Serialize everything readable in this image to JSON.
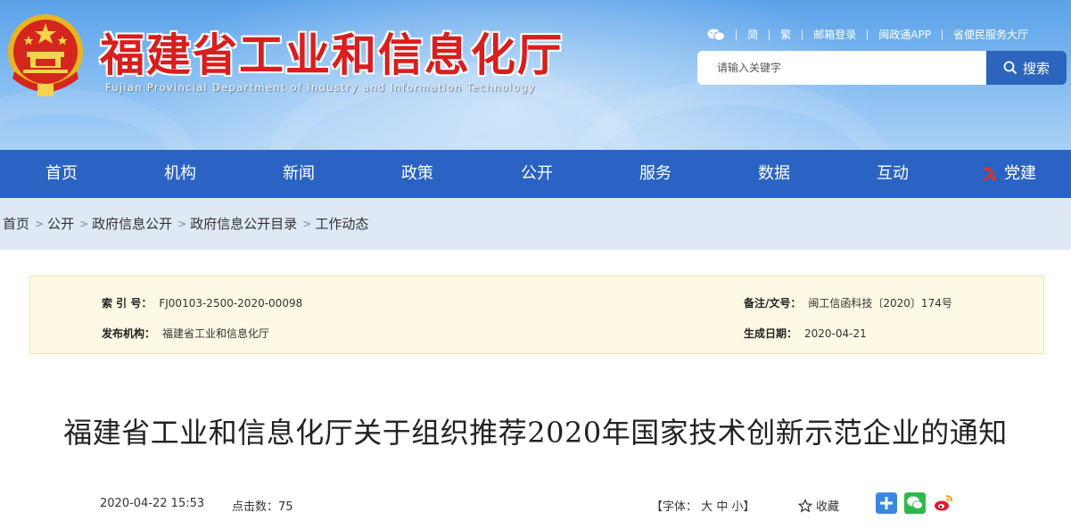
{
  "header": {
    "title": "福建省工业和信息化厅",
    "subtitle": "Fujian Provincial Department of Industry and Information Technology",
    "links": [
      "简",
      "繁",
      "邮箱登录",
      "闽政通APP",
      "省便民服务大厅"
    ],
    "search_placeholder": "请输入关键字",
    "search_button": "搜索"
  },
  "nav": {
    "items": [
      "首页",
      "机构",
      "新闻",
      "政策",
      "公开",
      "服务",
      "数据",
      "互动",
      "党建"
    ]
  },
  "breadcrumb": [
    "首页",
    "公开",
    "政府信息公开",
    "政府信息公开目录",
    "工作动态"
  ],
  "info": {
    "index_label": "索 引 号：",
    "index_value": "FJ00103-2500-2020-00098",
    "ref_label": "备注/文号：",
    "ref_value": "闽工信函科技〔2020〕174号",
    "issuer_label": "发布机构：",
    "issuer_value": "福建省工业和信息化厅",
    "date_label": "生成日期：",
    "date_value": "2020-04-21"
  },
  "article": {
    "title": "福建省工业和信息化厅关于组织推荐2020年国家技术创新示范企业的通知",
    "datetime": "2020-04-22 15:53",
    "clicks_label": "点击数：",
    "clicks": "75",
    "font_label": "【字体：",
    "font_large": "大",
    "font_medium": "中",
    "font_small": "小",
    "font_close": "】",
    "favorite": "收藏"
  },
  "colors": {
    "nav": "#2a63c4",
    "title_red": "#d81e1e",
    "search_button": "#2c64be",
    "info_bg": "#fdf9e4"
  }
}
